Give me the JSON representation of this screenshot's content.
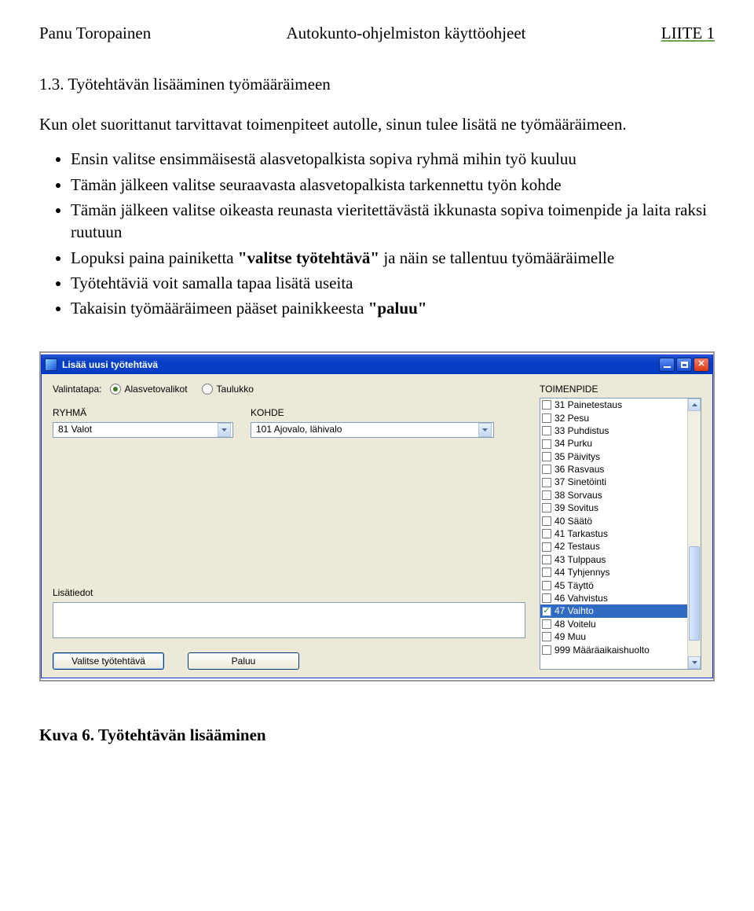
{
  "header": {
    "left": "Panu Toropainen",
    "center": "Autokunto-ohjelmiston käyttöohjeet",
    "right": "LIITE 1"
  },
  "section": {
    "heading": "1.3. Työtehtävän lisääminen työmääräimeen",
    "intro": "Kun olet suorittanut tarvittavat toimenpiteet autolle, sinun tulee lisätä ne työmääräimeen.",
    "bullets": [
      {
        "text": "Ensin valitse ensimmäisestä alasvetopalkista sopiva ryhmä mihin työ kuuluu"
      },
      {
        "text": "Tämän jälkeen valitse seuraavasta alasvetopalkista tarkennettu työn kohde"
      },
      {
        "text": "Tämän jälkeen valitse oikeasta reunasta vieritettävästä ikkunasta sopiva toimenpide ja laita raksi ruutuun"
      },
      {
        "pre": "Lopuksi paina painiketta ",
        "kw": "\"valitse työtehtävä\"",
        "post": " ja näin se tallentuu työmääräimelle"
      },
      {
        "text": "Työtehtäviä voit samalla tapaa lisätä useita"
      },
      {
        "pre": "Takaisin työmääräimeen pääset painikkeesta ",
        "kw": "\"paluu\""
      }
    ]
  },
  "window": {
    "title": "Lisää uusi työtehtävä",
    "valintatapa_label": "Valintatapa:",
    "radio1": "Alasvetovalikot",
    "radio2": "Taulukko",
    "ryhma": {
      "label": "RYHMÄ",
      "value": "81 Valot"
    },
    "kohde": {
      "label": "KOHDE",
      "value": "101 Ajovalo, lähivalo"
    },
    "toimenpide_label": "TOIMENPIDE",
    "lisatiedot_label": "Lisätiedot",
    "btn_valitse": "Valitse työtehtävä",
    "btn_paluu": "Paluu",
    "list": [
      {
        "label": "31 Painetestaus",
        "checked": false
      },
      {
        "label": "32 Pesu",
        "checked": false
      },
      {
        "label": "33 Puhdistus",
        "checked": false
      },
      {
        "label": "34 Purku",
        "checked": false
      },
      {
        "label": "35 Päivitys",
        "checked": false
      },
      {
        "label": "36 Rasvaus",
        "checked": false
      },
      {
        "label": "37 Sinetöinti",
        "checked": false
      },
      {
        "label": "38 Sorvaus",
        "checked": false
      },
      {
        "label": "39 Sovitus",
        "checked": false
      },
      {
        "label": "40 Säätö",
        "checked": false
      },
      {
        "label": "41 Tarkastus",
        "checked": false
      },
      {
        "label": "42 Testaus",
        "checked": false
      },
      {
        "label": "43 Tulppaus",
        "checked": false
      },
      {
        "label": "44 Tyhjennys",
        "checked": false
      },
      {
        "label": "45 Täyttö",
        "checked": false
      },
      {
        "label": "46 Vahvistus",
        "checked": false
      },
      {
        "label": "47 Vaihto",
        "checked": true,
        "selected": true
      },
      {
        "label": "48 Voitelu",
        "checked": false
      },
      {
        "label": "49 Muu",
        "checked": false
      },
      {
        "label": "999 Määräaikaishuolto",
        "checked": false
      }
    ]
  },
  "caption": "Kuva 6. Työtehtävän lisääminen"
}
